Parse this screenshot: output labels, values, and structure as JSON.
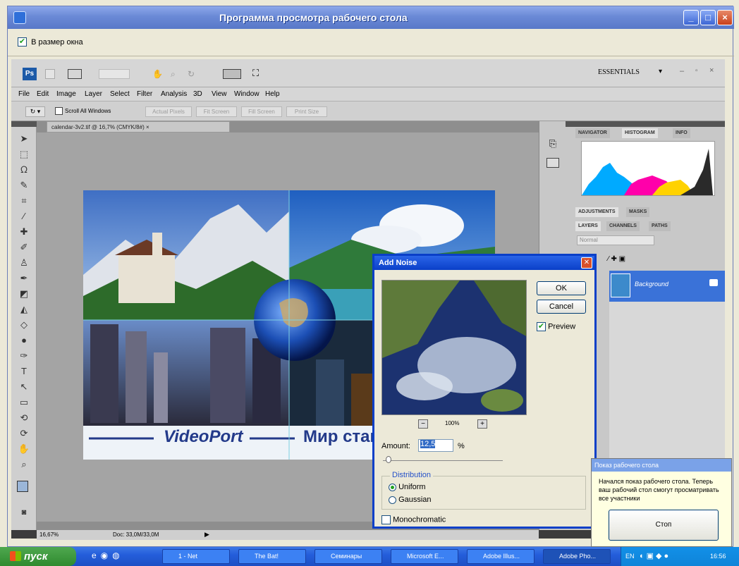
{
  "window": {
    "title": "Программа просмотра рабочего стола",
    "fit_checkbox_label": "В размер окна",
    "fit_checked": true
  },
  "photoshop": {
    "workspace": "ESSENTIALS",
    "menu": [
      "File",
      "Edit",
      "Image",
      "Layer",
      "Select",
      "Filter",
      "Analysis",
      "3D",
      "View",
      "Window",
      "Help"
    ],
    "options": {
      "scroll_all": "Scroll All Windows",
      "buttons": [
        "Actual Pixels",
        "Fit Screen",
        "Fill Screen",
        "Print Size"
      ]
    },
    "doc_tab": "calendar-3v2.tif @ 16,7% (CMYK/8#) ×",
    "status": {
      "zoom": "16,67%",
      "doc": "Doc: 33,0M/33,0M"
    },
    "canvas": {
      "brand_text": "VideoPort",
      "headline": "Мир станов"
    },
    "panel_tabs_top": [
      "NAVIGATOR",
      "HISTOGRAM",
      "INFO"
    ],
    "panel_tabs_mid": [
      "ADJUSTMENTS",
      "MASKS"
    ],
    "panel_tabs_layers": [
      "LAYERS",
      "CHANNELS",
      "PATHS"
    ],
    "layer_mode": "Normal",
    "layer_name": "Background",
    "histogram_colors": [
      "#00aaff",
      "#ff00aa",
      "#ffd200",
      "#2a2a2a"
    ]
  },
  "dialog": {
    "title": "Add Noise",
    "ok": "OK",
    "cancel": "Cancel",
    "preview_label": "Preview",
    "preview_checked": true,
    "zoom": "100%",
    "amount_label": "Amount:",
    "amount_value": "12,5",
    "amount_unit": "%",
    "distribution_label": "Distribution",
    "uniform_label": "Uniform",
    "gaussian_label": "Gaussian",
    "selected_distribution": "Uniform",
    "mono_label": "Monochromatic",
    "mono_checked": false
  },
  "balloon": {
    "title": "Показ рабочего стола",
    "text": "Начался показ рабочего стола. Теперь ваш рабочий стол смогут просматривать все участники",
    "button": "Стоп"
  },
  "taskbar": {
    "start": "пуск",
    "tasks": [
      "1 - Net",
      "The Bat!",
      "Семинары",
      "Microsoft E...",
      "Adobe Illus...",
      "Adobe Pho..."
    ],
    "tray_lang": "EN",
    "clock": "16:56"
  }
}
